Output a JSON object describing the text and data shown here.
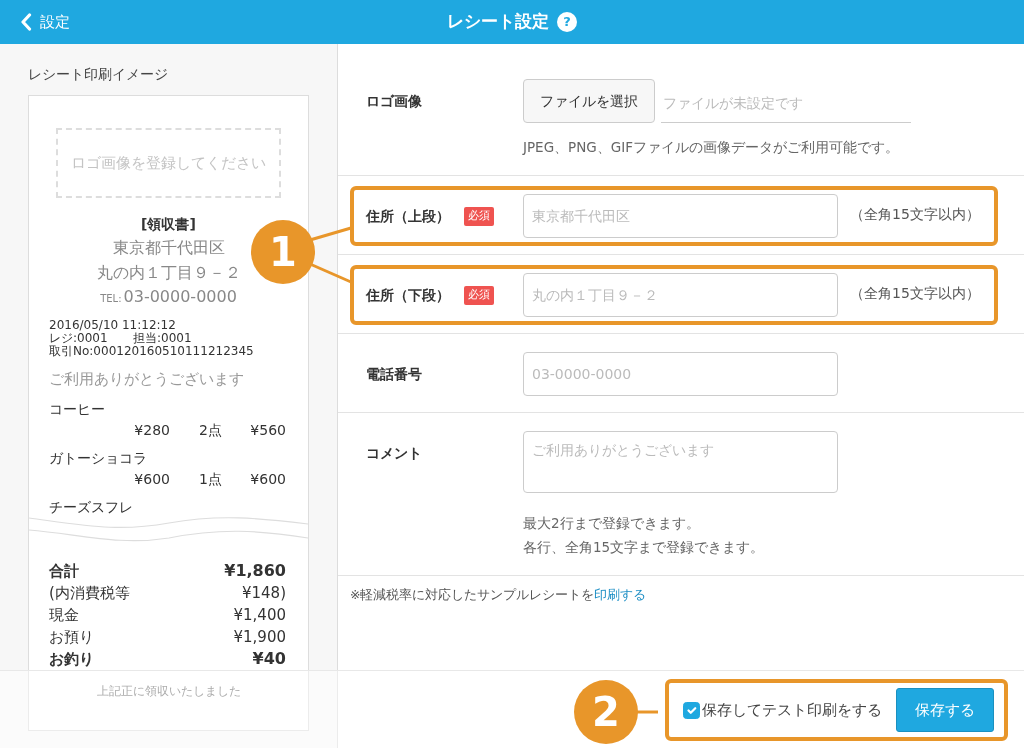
{
  "header": {
    "back": "設定",
    "title": "レシート設定",
    "help": "?"
  },
  "preview": {
    "title": "レシート印刷イメージ",
    "logo_placeholder": "ロゴ画像を登録してください",
    "heading": "[領収書]",
    "address": [
      "東京都千代田区",
      "丸の内１丁目９－２"
    ],
    "tel_label": "TEL:",
    "tel": "03-0000-0000",
    "datetime": "2016/05/10 11:12:12",
    "register": "レジ:0001",
    "staff": "担当:0001",
    "transaction": "取引No:000120160510111212345",
    "thanks": "ご利用ありがとうございます",
    "items": [
      {
        "name": "コーヒー",
        "price": "¥280",
        "qty": "2点",
        "total": "¥560"
      },
      {
        "name": "ガトーショコラ",
        "price": "¥600",
        "qty": "1点",
        "total": "¥600"
      },
      {
        "name": "チーズスフレ"
      }
    ],
    "totals": [
      {
        "label": "合計",
        "value": "¥1,860",
        "bold": true
      },
      {
        "label": "(内消費税等",
        "value": "¥148)",
        "bold": false
      },
      {
        "label": "現金",
        "value": "¥1,400",
        "bold": false
      },
      {
        "label": "お預り",
        "value": "¥1,900",
        "bold": false
      },
      {
        "label": "お釣り",
        "value": "¥40",
        "bold": true
      }
    ],
    "closing": "上記正に領収いたしました"
  },
  "form": [
    {
      "kind": "file",
      "label": "ロゴ画像",
      "button": "ファイルを選択",
      "placeholder": "ファイルが未設定です",
      "help": [
        "JPEG、PNG、GIFファイルの画像データがご利用可能です。"
      ],
      "highlighted": false
    },
    {
      "kind": "text",
      "label": "住所（上段）",
      "required": "必須",
      "placeholder": "東京都千代田区",
      "hint": "（全角15文字以内）",
      "highlighted": true
    },
    {
      "kind": "text",
      "label": "住所（下段）",
      "required": "必須",
      "placeholder": "丸の内１丁目９－２",
      "hint": "（全角15文字以内）",
      "highlighted": true
    },
    {
      "kind": "text",
      "label": "電話番号",
      "placeholder": "03-0000-0000",
      "highlighted": false
    },
    {
      "kind": "textarea",
      "label": "コメント",
      "placeholder": "ご利用ありがとうございます",
      "help": [
        "最大2行まで登録できます。",
        "各行、全角15文字まで登録できます。"
      ],
      "highlighted": false
    }
  ],
  "note": {
    "text": "※軽減税率に対応したサンプルレシートを",
    "link": "印刷する"
  },
  "footer": {
    "checkbox": {
      "label": "保存してテスト印刷をする",
      "checked": true
    },
    "save": "保存する",
    "highlighted": true
  },
  "callouts": [
    {
      "label": "1"
    },
    {
      "label": "2"
    }
  ]
}
